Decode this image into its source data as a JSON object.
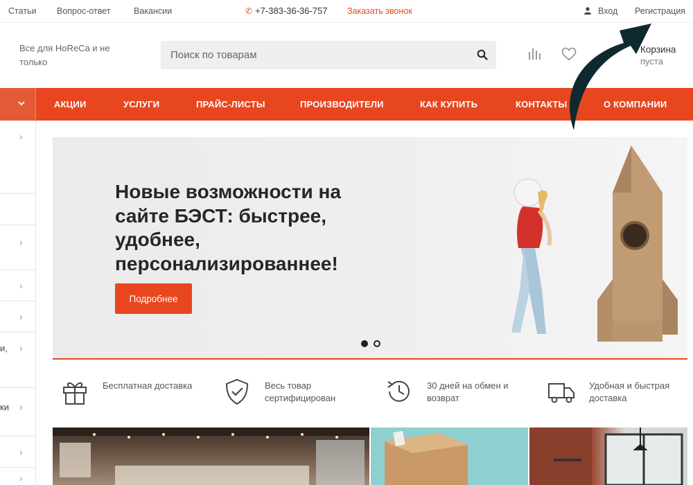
{
  "topbar": {
    "links": [
      "Статьи",
      "Вопрос-ответ",
      "Вакансии"
    ],
    "phone": "+7-383-36-36-757",
    "callback": "Заказать звонок",
    "login": "Вход",
    "register": "Регистрация"
  },
  "header": {
    "tagline": "Все для HoReCa и не только",
    "search_placeholder": "Поиск по товарам",
    "cart_title": "Корзина",
    "cart_status": "пуста"
  },
  "nav": {
    "items": [
      "АКЦИИ",
      "УСЛУГИ",
      "ПРАЙС-ЛИСТЫ",
      "ПРОИЗВОДИТЕЛИ",
      "КАК КУПИТЬ",
      "КОНТАКТЫ",
      "О КОМПАНИИ"
    ]
  },
  "sidebar": {
    "fragments": [
      "и,",
      "ки"
    ]
  },
  "banner": {
    "title": "Новые возможности на сайте БЭСТ: быстрее, удобнее, персонализированнее!",
    "button": "Подробнее",
    "slides_total": 2,
    "slide_active": 1
  },
  "features": [
    {
      "icon": "gift-icon",
      "text": "Бесплатная доставка"
    },
    {
      "icon": "shield-check-icon",
      "text": "Весь товар сертифицирован"
    },
    {
      "icon": "clock-return-icon",
      "text": "30 дней на обмен и возврат"
    },
    {
      "icon": "truck-icon",
      "text": "Удобная и быстрая доставка"
    }
  ],
  "colors": {
    "accent": "#e8461f",
    "arrow": "#0f2a2e"
  }
}
